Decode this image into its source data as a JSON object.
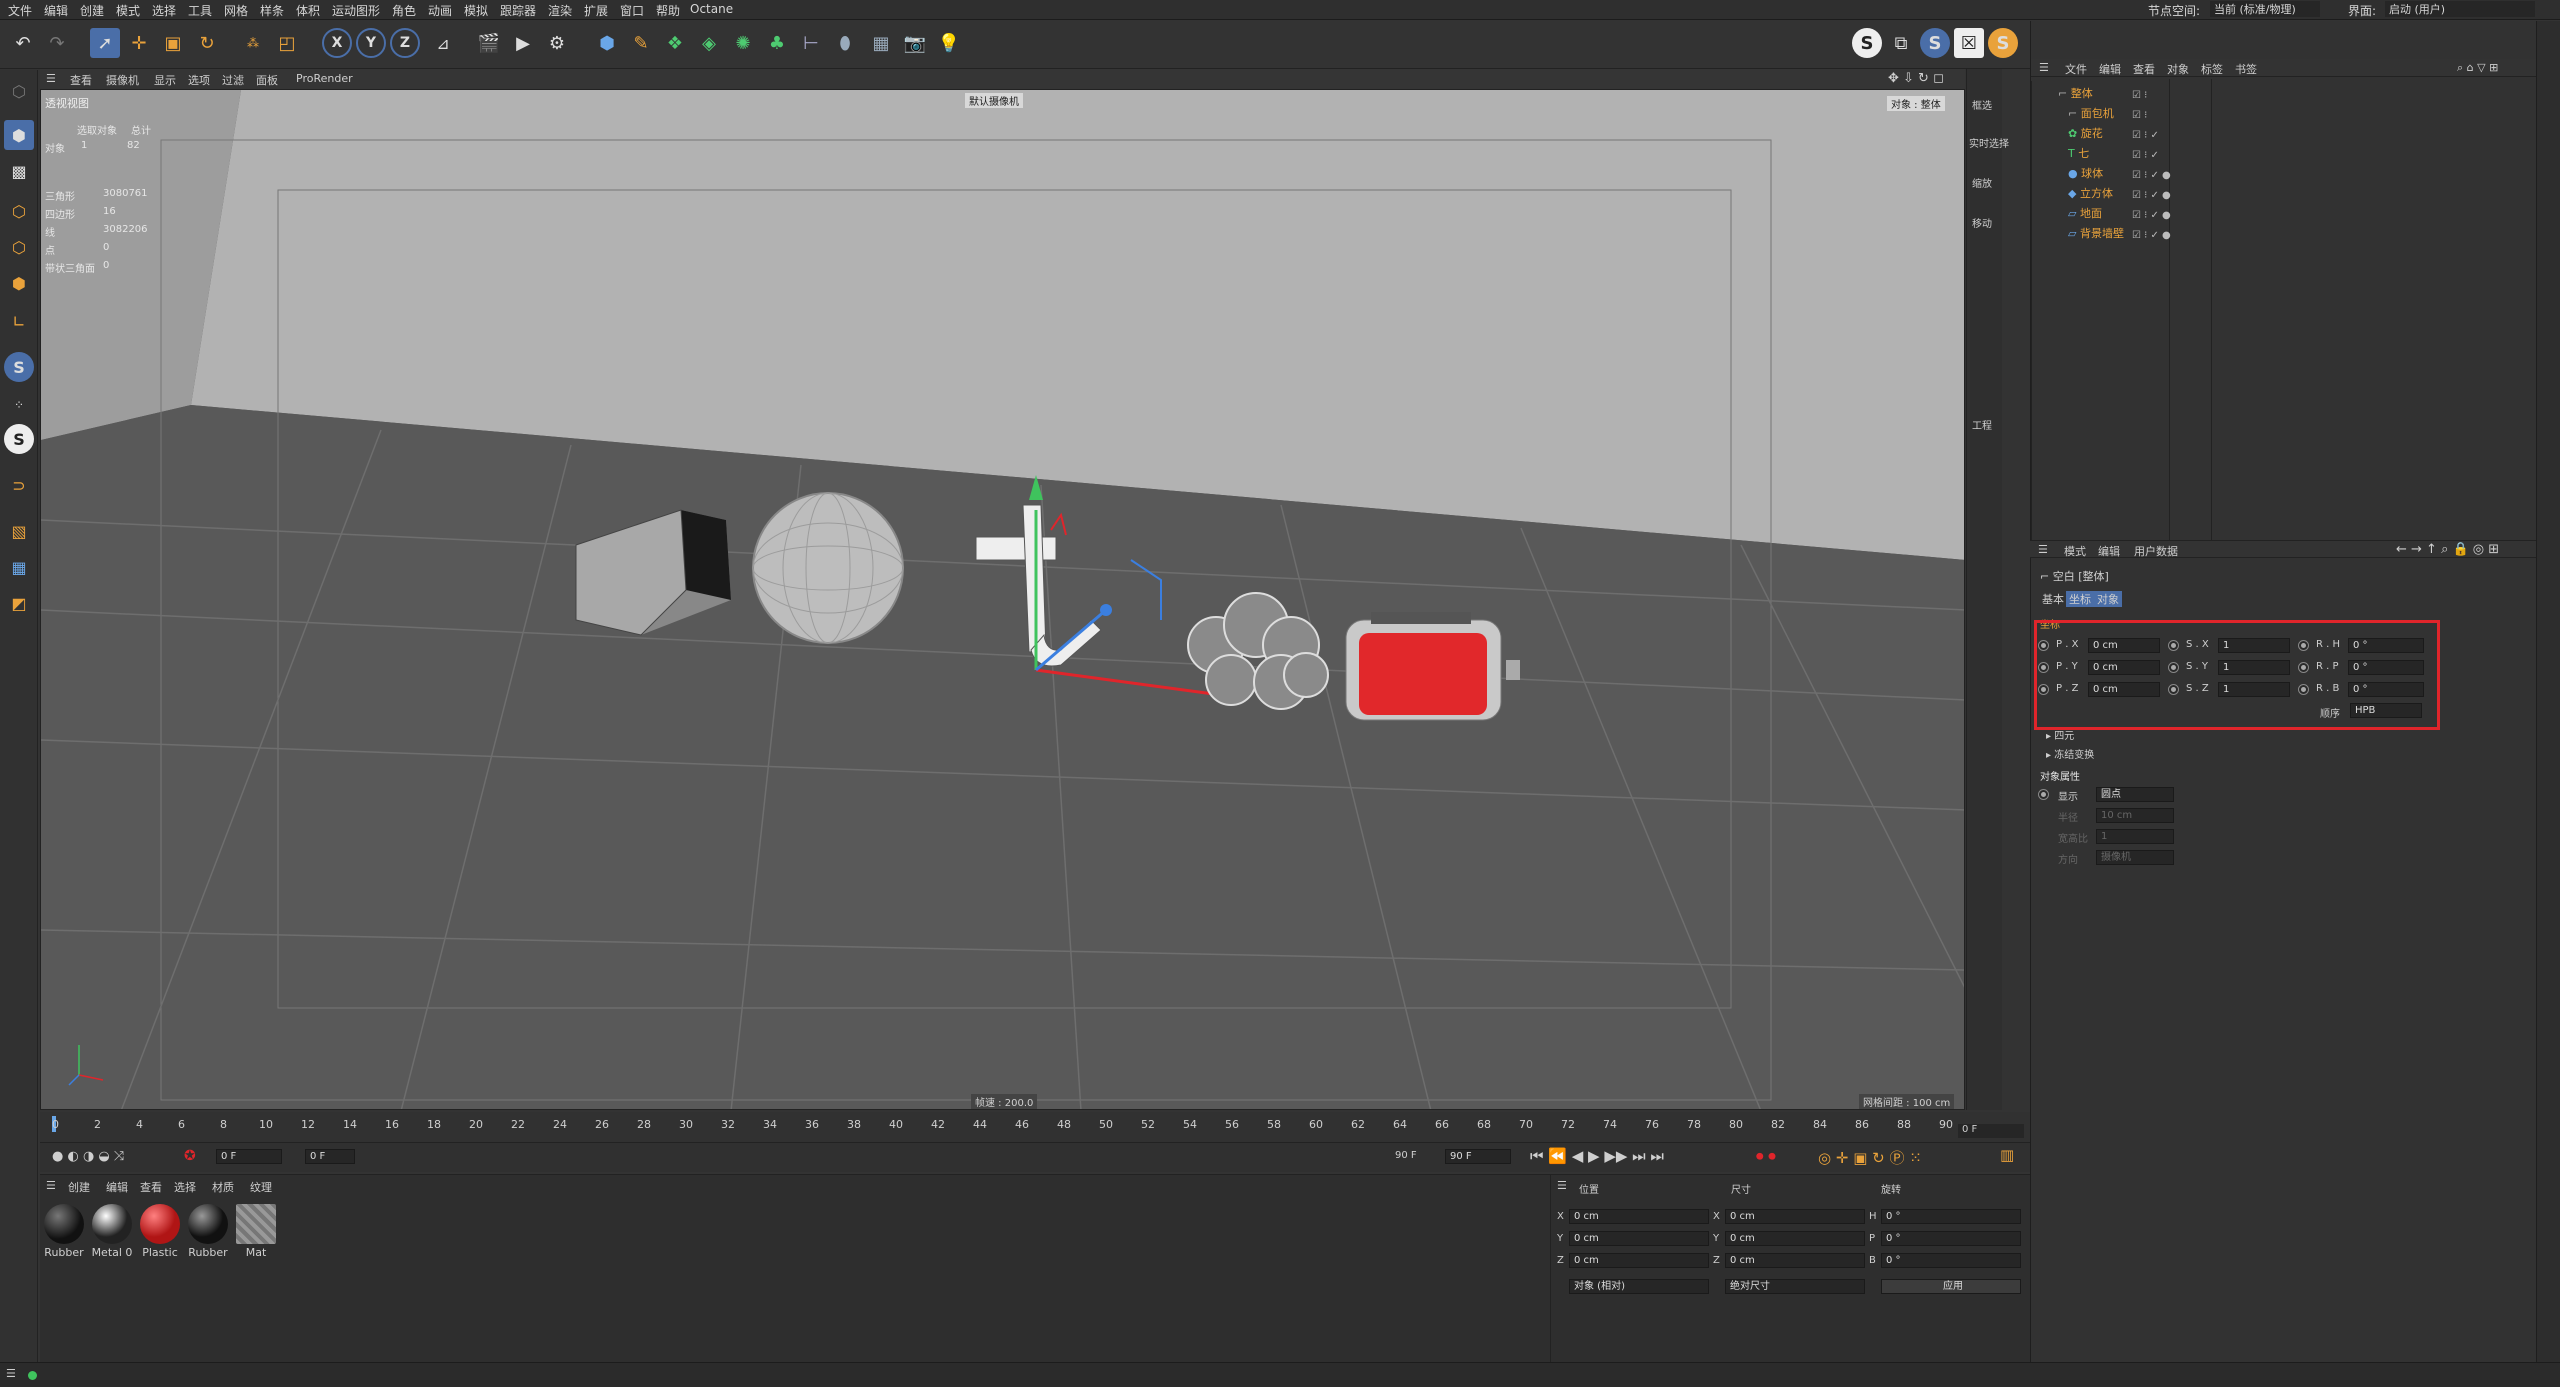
{
  "menu": [
    "文件",
    "编辑",
    "创建",
    "模式",
    "选择",
    "工具",
    "网格",
    "样条",
    "体积",
    "运动图形",
    "角色",
    "动画",
    "模拟",
    "跟踪器",
    "渲染",
    "扩展",
    "窗口",
    "帮助",
    "Octane"
  ],
  "node_space_label": "节点空间:",
  "node_space_value": "当前 (标准/物理)",
  "interface_label": "界面:",
  "interface_value": "启动 (用户)",
  "viewport": {
    "menu": [
      "查看",
      "摄像机",
      "显示",
      "选项",
      "过滤",
      "面板",
      "ProRender"
    ],
    "title": "透视视图",
    "camera_label": "默认摄像机",
    "object_tag": "对象 : 整体",
    "speed": "帧速 : 200.0",
    "grid_spacing": "网格间距 : 100 cm",
    "stats": {
      "header_selected": "选取对象",
      "header_total": "总计",
      "rows": [
        {
          "label": "对象",
          "a": "1",
          "b": "82"
        },
        {
          "label": "三角形",
          "a": "3080761",
          "b": ""
        },
        {
          "label": "四边形",
          "a": "16",
          "b": ""
        },
        {
          "label": "线",
          "a": "3082206",
          "b": ""
        },
        {
          "label": "点",
          "a": "0",
          "b": ""
        },
        {
          "label": "带状三角面",
          "a": "0",
          "b": ""
        }
      ]
    }
  },
  "right_strip": [
    "框选",
    "实时选择",
    "缩放",
    "移动",
    "工程"
  ],
  "object_manager": {
    "menu": [
      "文件",
      "编辑",
      "查看",
      "对象",
      "标签",
      "书签"
    ],
    "objects": [
      {
        "name": "整体",
        "indent": 0
      },
      {
        "name": "面包机",
        "indent": 1
      },
      {
        "name": "旋花",
        "indent": 1
      },
      {
        "name": "七",
        "indent": 1
      },
      {
        "name": "球体",
        "indent": 1
      },
      {
        "name": "立方体",
        "indent": 1
      },
      {
        "name": "地面",
        "indent": 1
      },
      {
        "name": "背景墙壁",
        "indent": 1
      }
    ]
  },
  "attributes": {
    "menu": [
      "模式",
      "编辑",
      "用户数据"
    ],
    "title": "空白 [整体]",
    "tabs": [
      "基本",
      "坐标",
      "对象"
    ],
    "section_coord": "坐标",
    "pos": [
      {
        "label": "P . X",
        "value": "0 cm"
      },
      {
        "label": "P . Y",
        "value": "0 cm"
      },
      {
        "label": "P . Z",
        "value": "0 cm"
      }
    ],
    "scale": [
      {
        "label": "S . X",
        "value": "1"
      },
      {
        "label": "S . Y",
        "value": "1"
      },
      {
        "label": "S . Z",
        "value": "1"
      }
    ],
    "rot": [
      {
        "label": "R . H",
        "value": "0 °"
      },
      {
        "label": "R . P",
        "value": "0 °"
      },
      {
        "label": "R . B",
        "value": "0 °"
      }
    ],
    "order_label": "顺序",
    "order_value": "HPB",
    "quaternion": "四元",
    "freeze": "冻结变换",
    "obj_props": "对象属性",
    "display_label": "显示",
    "display_value": "圆点",
    "radius_label": "半径",
    "radius_value": "10 cm",
    "aspect_label": "宽高比",
    "aspect_value": "1",
    "orient_label": "方向",
    "orient_value": "摄像机"
  },
  "timeline": {
    "ticks": [
      "0",
      "2",
      "4",
      "6",
      "8",
      "10",
      "12",
      "14",
      "16",
      "18",
      "20",
      "22",
      "24",
      "26",
      "28",
      "30",
      "32",
      "34",
      "36",
      "38",
      "40",
      "42",
      "44",
      "46",
      "48",
      "50",
      "52",
      "54",
      "56",
      "58",
      "60",
      "62",
      "64",
      "66",
      "68",
      "70",
      "72",
      "74",
      "76",
      "78",
      "80",
      "82",
      "84",
      "86",
      "88",
      "90"
    ],
    "frame_end": "0 F"
  },
  "playbar": {
    "current": "0 F",
    "start": "0 F",
    "end_a": "90 F",
    "end_b": "90 F"
  },
  "materials": {
    "menu": [
      "创建",
      "编辑",
      "查看",
      "选择",
      "材质",
      "纹理"
    ],
    "items": [
      {
        "name": "Rubber",
        "color": "#111"
      },
      {
        "name": "Metal 0",
        "color": "#333"
      },
      {
        "name": "Plastic",
        "color": "#c62020"
      },
      {
        "name": "Rubber",
        "color": "#151515"
      },
      {
        "name": "Mat",
        "color": "#888"
      }
    ]
  },
  "coords": {
    "headers": [
      "位置",
      "尺寸",
      "旋转"
    ],
    "rows": [
      {
        "axis": "X",
        "pos": "0 cm",
        "size_axis": "X",
        "size": "0 cm",
        "rot_axis": "H",
        "rot": "0 °"
      },
      {
        "axis": "Y",
        "pos": "0 cm",
        "size_axis": "Y",
        "size": "0 cm",
        "rot_axis": "P",
        "rot": "0 °"
      },
      {
        "axis": "Z",
        "pos": "0 cm",
        "size_axis": "Z",
        "size": "0 cm",
        "rot_axis": "B",
        "rot": "0 °"
      }
    ],
    "mode_value": "对象 (相对)",
    "size_mode_value": "绝对尺寸",
    "apply_label": "应用"
  },
  "colors": {
    "accent": "#e9a23b",
    "highlight": "#e0252b",
    "selected": "#4a6ea8"
  }
}
